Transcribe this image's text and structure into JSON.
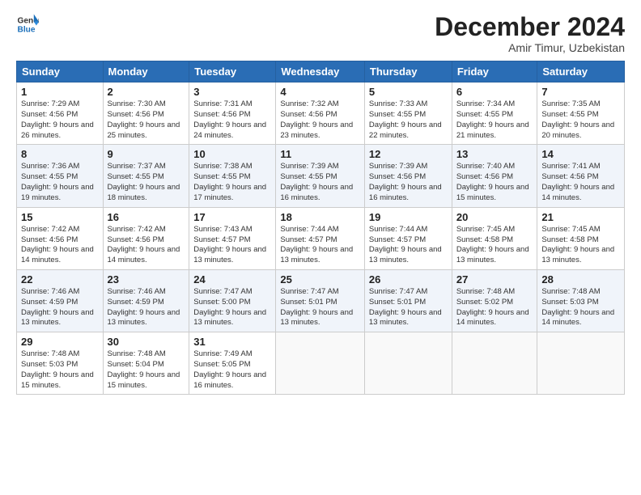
{
  "logo": {
    "line1": "General",
    "line2": "Blue"
  },
  "title": "December 2024",
  "subtitle": "Amir Timur, Uzbekistan",
  "days_of_week": [
    "Sunday",
    "Monday",
    "Tuesday",
    "Wednesday",
    "Thursday",
    "Friday",
    "Saturday"
  ],
  "weeks": [
    [
      {
        "day": 1,
        "sunrise": "7:29 AM",
        "sunset": "4:56 PM",
        "daylight": "9 hours and 26 minutes."
      },
      {
        "day": 2,
        "sunrise": "7:30 AM",
        "sunset": "4:56 PM",
        "daylight": "9 hours and 25 minutes."
      },
      {
        "day": 3,
        "sunrise": "7:31 AM",
        "sunset": "4:56 PM",
        "daylight": "9 hours and 24 minutes."
      },
      {
        "day": 4,
        "sunrise": "7:32 AM",
        "sunset": "4:56 PM",
        "daylight": "9 hours and 23 minutes."
      },
      {
        "day": 5,
        "sunrise": "7:33 AM",
        "sunset": "4:55 PM",
        "daylight": "9 hours and 22 minutes."
      },
      {
        "day": 6,
        "sunrise": "7:34 AM",
        "sunset": "4:55 PM",
        "daylight": "9 hours and 21 minutes."
      },
      {
        "day": 7,
        "sunrise": "7:35 AM",
        "sunset": "4:55 PM",
        "daylight": "9 hours and 20 minutes."
      }
    ],
    [
      {
        "day": 8,
        "sunrise": "7:36 AM",
        "sunset": "4:55 PM",
        "daylight": "9 hours and 19 minutes."
      },
      {
        "day": 9,
        "sunrise": "7:37 AM",
        "sunset": "4:55 PM",
        "daylight": "9 hours and 18 minutes."
      },
      {
        "day": 10,
        "sunrise": "7:38 AM",
        "sunset": "4:55 PM",
        "daylight": "9 hours and 17 minutes."
      },
      {
        "day": 11,
        "sunrise": "7:39 AM",
        "sunset": "4:55 PM",
        "daylight": "9 hours and 16 minutes."
      },
      {
        "day": 12,
        "sunrise": "7:39 AM",
        "sunset": "4:56 PM",
        "daylight": "9 hours and 16 minutes."
      },
      {
        "day": 13,
        "sunrise": "7:40 AM",
        "sunset": "4:56 PM",
        "daylight": "9 hours and 15 minutes."
      },
      {
        "day": 14,
        "sunrise": "7:41 AM",
        "sunset": "4:56 PM",
        "daylight": "9 hours and 14 minutes."
      }
    ],
    [
      {
        "day": 15,
        "sunrise": "7:42 AM",
        "sunset": "4:56 PM",
        "daylight": "9 hours and 14 minutes."
      },
      {
        "day": 16,
        "sunrise": "7:42 AM",
        "sunset": "4:56 PM",
        "daylight": "9 hours and 14 minutes."
      },
      {
        "day": 17,
        "sunrise": "7:43 AM",
        "sunset": "4:57 PM",
        "daylight": "9 hours and 13 minutes."
      },
      {
        "day": 18,
        "sunrise": "7:44 AM",
        "sunset": "4:57 PM",
        "daylight": "9 hours and 13 minutes."
      },
      {
        "day": 19,
        "sunrise": "7:44 AM",
        "sunset": "4:57 PM",
        "daylight": "9 hours and 13 minutes."
      },
      {
        "day": 20,
        "sunrise": "7:45 AM",
        "sunset": "4:58 PM",
        "daylight": "9 hours and 13 minutes."
      },
      {
        "day": 21,
        "sunrise": "7:45 AM",
        "sunset": "4:58 PM",
        "daylight": "9 hours and 13 minutes."
      }
    ],
    [
      {
        "day": 22,
        "sunrise": "7:46 AM",
        "sunset": "4:59 PM",
        "daylight": "9 hours and 13 minutes."
      },
      {
        "day": 23,
        "sunrise": "7:46 AM",
        "sunset": "4:59 PM",
        "daylight": "9 hours and 13 minutes."
      },
      {
        "day": 24,
        "sunrise": "7:47 AM",
        "sunset": "5:00 PM",
        "daylight": "9 hours and 13 minutes."
      },
      {
        "day": 25,
        "sunrise": "7:47 AM",
        "sunset": "5:01 PM",
        "daylight": "9 hours and 13 minutes."
      },
      {
        "day": 26,
        "sunrise": "7:47 AM",
        "sunset": "5:01 PM",
        "daylight": "9 hours and 13 minutes."
      },
      {
        "day": 27,
        "sunrise": "7:48 AM",
        "sunset": "5:02 PM",
        "daylight": "9 hours and 14 minutes."
      },
      {
        "day": 28,
        "sunrise": "7:48 AM",
        "sunset": "5:03 PM",
        "daylight": "9 hours and 14 minutes."
      }
    ],
    [
      {
        "day": 29,
        "sunrise": "7:48 AM",
        "sunset": "5:03 PM",
        "daylight": "9 hours and 15 minutes."
      },
      {
        "day": 30,
        "sunrise": "7:48 AM",
        "sunset": "5:04 PM",
        "daylight": "9 hours and 15 minutes."
      },
      {
        "day": 31,
        "sunrise": "7:49 AM",
        "sunset": "5:05 PM",
        "daylight": "9 hours and 16 minutes."
      },
      null,
      null,
      null,
      null
    ]
  ],
  "labels": {
    "sunrise": "Sunrise:",
    "sunset": "Sunset:",
    "daylight": "Daylight:"
  }
}
